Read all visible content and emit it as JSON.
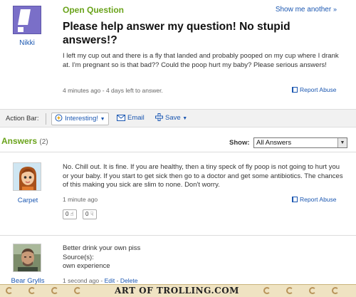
{
  "question": {
    "status": "Open Question",
    "show_another": "Show me another",
    "asker_name": "Nikki",
    "title": "Please help answer my question! No stupid answers!?",
    "body": "I left my cup out and there is a fly that landed and probably pooped on my cup where I drank at. I'm pregnant so is that bad?? Could the poop hurt my baby? Please serious answers!",
    "meta": "4 minutes ago - 4 days left to answer.",
    "report_label": "Report Abuse"
  },
  "action_bar": {
    "label": "Action Bar:",
    "interesting_label": "Interesting!",
    "email_label": "Email",
    "save_label": "Save"
  },
  "answers": {
    "heading": "Answers",
    "count": "(2)",
    "show_label": "Show:",
    "show_value": "All Answers",
    "items": [
      {
        "name": "Carpet",
        "text": "No. Chill out. It is fine. If you are healthy, then a tiny speck of fly poop is not going to hurt you or your baby. If you start to get sick then go to a doctor and get some antibiotics. The chances of this making you sick are slim to none. Don't worry.",
        "time": "1 minute ago",
        "report_label": "Report Abuse",
        "thumbs_up": "0",
        "thumbs_down": "0"
      },
      {
        "name": "Bear Grylls",
        "text": "Better drink your own piss",
        "sources_label": "Source(s):",
        "source": "own experience",
        "time": "1 second ago",
        "edit_label": "Edit",
        "delete_label": "Delete",
        "sep": "-"
      }
    ]
  },
  "footer": {
    "watermark": "ART OF TROLLING.COM"
  },
  "colors": {
    "accent_green": "#6aa31b",
    "link_blue": "#1b57b1"
  },
  "icons": {
    "asker": "exclamation-avatar-icon",
    "interesting": "sparkle-icon",
    "email": "envelope-icon",
    "save": "plus-icon",
    "report": "flag-icon",
    "thumbs_up": "thumbs-up-icon",
    "thumbs_down": "thumbs-down-icon"
  }
}
